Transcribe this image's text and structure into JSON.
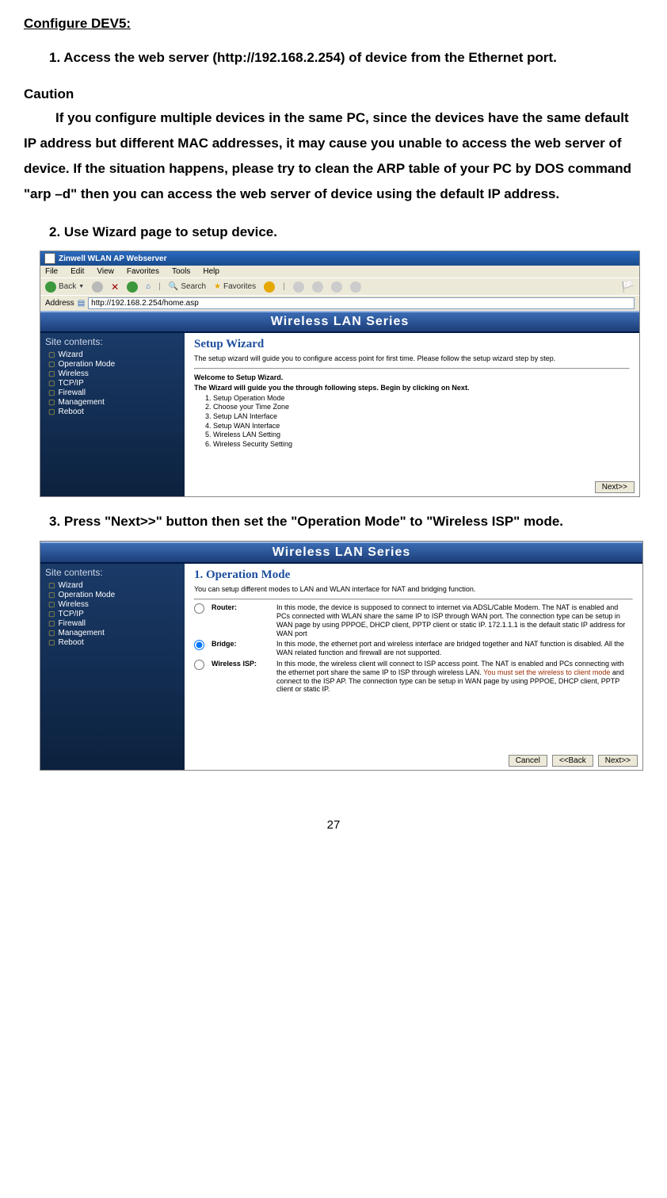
{
  "doc": {
    "title": "Configure DEV5:",
    "step1": "1.  Access the web server (http://192.168.2.254) of device from the Ethernet port.",
    "caution_label": "Caution",
    "caution_body": "If you configure multiple devices in the same PC, since the devices have the same default IP address but different MAC addresses, it may cause you unable to access the web server of device. If the situation happens, please try to clean the ARP table of your PC by DOS command \"arp –d\" then you can access the web server of device using the default IP address.",
    "step2": "2.  Use Wizard page to setup device.",
    "step3": "3.  Press \"Next>>\" button then set the \"Operation Mode\" to \"Wireless ISP\" mode.",
    "page_number": "27"
  },
  "ie": {
    "title": "Zinwell WLAN AP Webserver",
    "menu": [
      "File",
      "Edit",
      "View",
      "Favorites",
      "Tools",
      "Help"
    ],
    "back": "Back",
    "search": "Search",
    "favorites": "Favorites",
    "address_label": "Address",
    "url": "http://192.168.2.254/home.asp"
  },
  "wlan": {
    "header": "Wireless LAN Series",
    "sidebar_title": "Site contents:",
    "sidebar_items": [
      "Wizard",
      "Operation Mode",
      "Wireless",
      "TCP/IP",
      "Firewall",
      "Management",
      "Reboot"
    ]
  },
  "setup": {
    "title": "Setup Wizard",
    "desc": "The setup wizard will guide you to configure access point for first time. Please follow the setup wizard step by step.",
    "welcome": "Welcome to Setup Wizard.",
    "guide": "The Wizard will guide you the through following steps. Begin by clicking on Next.",
    "steps": [
      "Setup Operation Mode",
      "Choose your Time Zone",
      "Setup LAN Interface",
      "Setup WAN Interface",
      "Wireless LAN Setting",
      "Wireless Security Setting"
    ],
    "next": "Next>>"
  },
  "opmode": {
    "title": "1. Operation Mode",
    "desc": "You can setup different modes to LAN and WLAN interface for NAT and bridging function.",
    "router_label": "Router:",
    "router_text": "In this mode, the device is supposed to connect to internet via ADSL/Cable Modem. The NAT is enabled and PCs connected with WLAN share the same IP to ISP through WAN port. The connection type can be setup in WAN page by using PPPOE, DHCP client, PPTP client or static IP. 172.1.1.1 is the default static IP address for WAN port",
    "bridge_label": "Bridge:",
    "bridge_text": "In this mode, the ethernet port and wireless interface are bridged together and NAT function is disabled. All the WAN related function and firewall are not supported.",
    "wisp_label": "Wireless ISP:",
    "wisp_text_pre": "In this mode, the wireless client will connect to ISP access point. The NAT is enabled and PCs connecting with the ethernet port share the same IP to ISP through wireless LAN. ",
    "wisp_text_red": "You must set the wireless to client mode",
    "wisp_text_post": " and connect to the ISP AP. The connection type can be setup in WAN page by using PPPOE, DHCP client, PPTP client or static IP.",
    "cancel": "Cancel",
    "back": "<<Back",
    "next": "Next>>"
  }
}
